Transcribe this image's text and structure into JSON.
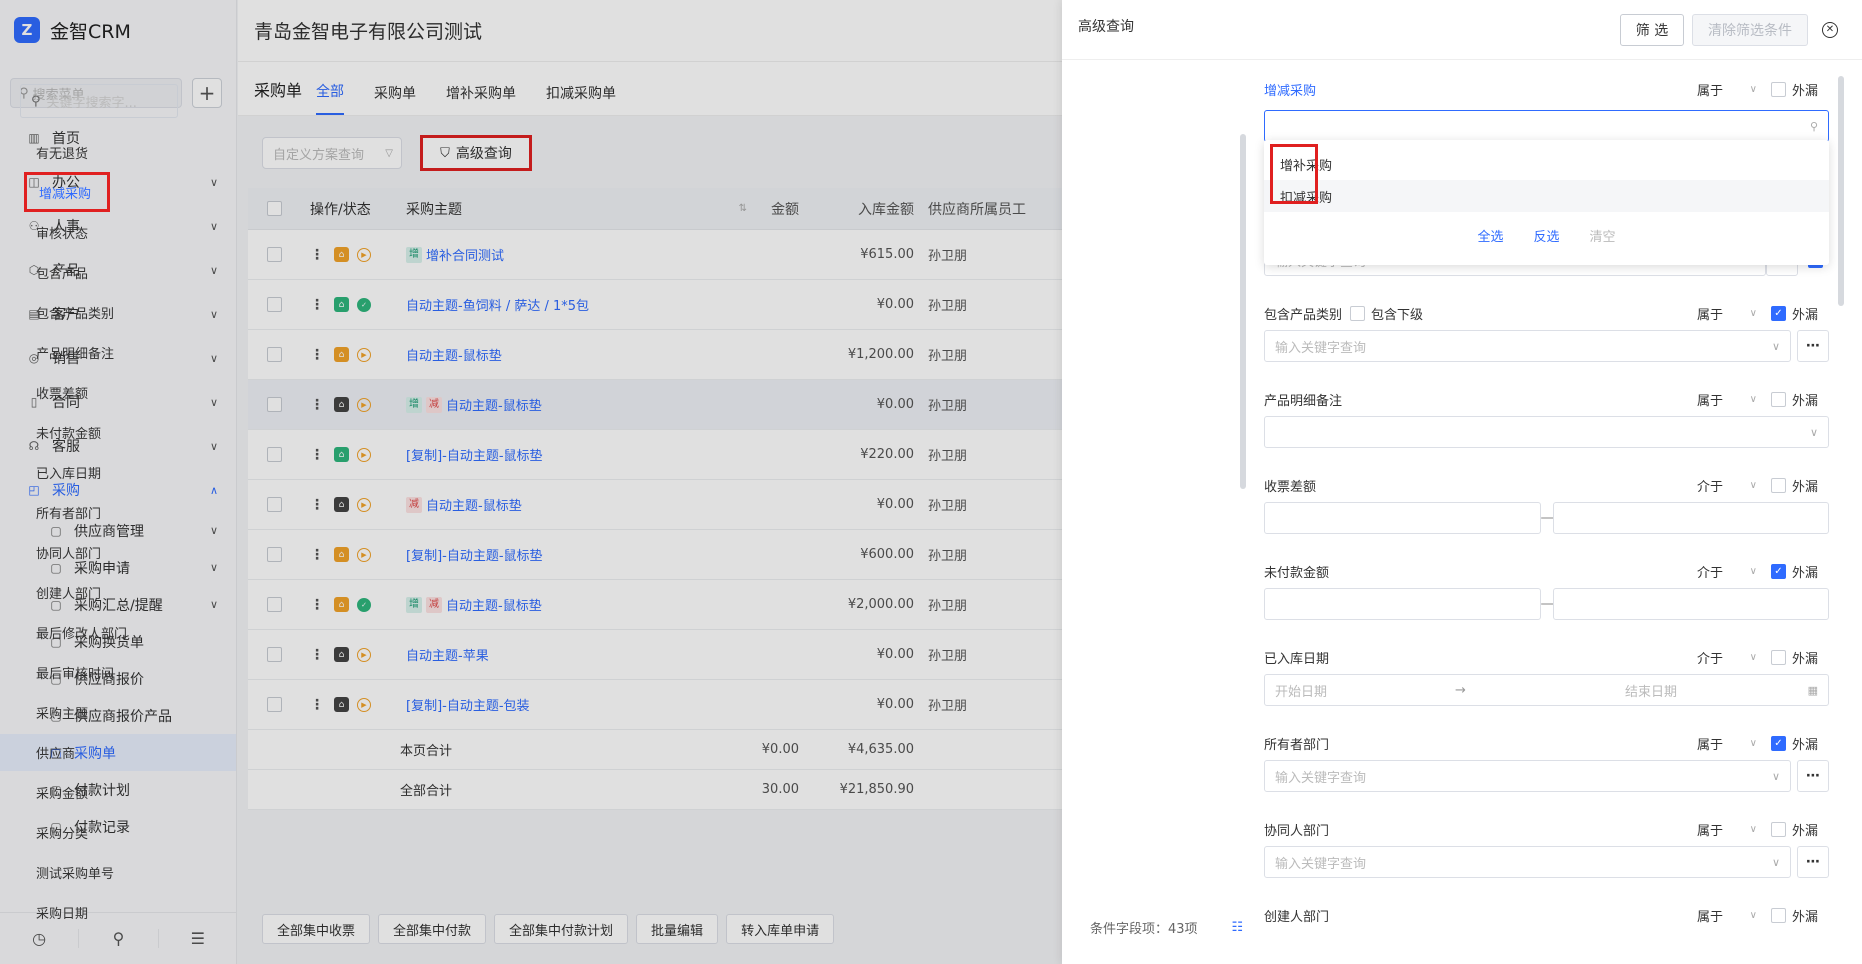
{
  "app": {
    "logo": "Z",
    "name": "金智CRM",
    "company": "青岛金智电子有限公司测试"
  },
  "sidebar": {
    "search_placeholder": "搜索菜单",
    "add": "+",
    "items": [
      {
        "label": "首页",
        "icon": "home-icon",
        "glyph": "▥"
      },
      {
        "label": "办公",
        "icon": "office-icon",
        "glyph": "◫",
        "chevron": "∨"
      },
      {
        "label": "人事",
        "icon": "people-icon",
        "glyph": "⚇",
        "chevron": "∨"
      },
      {
        "label": "产品",
        "icon": "cube-icon",
        "glyph": "⬡",
        "chevron": "∨"
      },
      {
        "label": "客户",
        "icon": "chart-icon",
        "glyph": "▤",
        "chevron": "∨"
      },
      {
        "label": "销售",
        "icon": "target-icon",
        "glyph": "◎",
        "chevron": "∨"
      },
      {
        "label": "合同",
        "icon": "contract-icon",
        "glyph": "▯",
        "chevron": "∨"
      },
      {
        "label": "客服",
        "icon": "headset-icon",
        "glyph": "☊",
        "chevron": "∨"
      },
      {
        "label": "采购",
        "icon": "purchase-icon",
        "glyph": "◰",
        "chevron": "∧"
      }
    ],
    "subitems": [
      {
        "label": "供应商管理",
        "chevron": "∨"
      },
      {
        "label": "采购申请",
        "chevron": "∨"
      },
      {
        "label": "采购汇总/提醒",
        "chevron": "∨"
      },
      {
        "label": "采购换货单"
      },
      {
        "label": "供应商报价"
      },
      {
        "label": "供应商报价产品"
      },
      {
        "label": "采购单"
      },
      {
        "label": "付款计划"
      },
      {
        "label": "付款记录"
      }
    ],
    "bottom": [
      "◷",
      "⚲",
      "☰"
    ]
  },
  "page": {
    "title": "采购单",
    "tabs": [
      "全部",
      "采购单",
      "增补采购单",
      "扣减采购单"
    ],
    "scheme_placeholder": "自定义方案查询",
    "adv_query": "高级查询"
  },
  "table": {
    "headers": {
      "op": "操作/状态",
      "subject": "采购主题",
      "amt1": "金额",
      "amt2": "入库金额",
      "emp": "供应商所属员工"
    },
    "rows": [
      {
        "st": "orange",
        "done": false,
        "tags": [
          "增"
        ],
        "subject": "增补合同测试",
        "amt1": "",
        "amt2": "¥615.00",
        "emp": "孙卫朋"
      },
      {
        "st": "green",
        "done": true,
        "tags": [],
        "subject": "自动主题-鱼饲料 / 萨达 / 1*5包",
        "amt1": "",
        "amt2": "¥0.00",
        "emp": "孙卫朋"
      },
      {
        "st": "orange",
        "done": false,
        "tags": [],
        "subject": "自动主题-鼠标垫",
        "amt1": "",
        "amt2": "¥1,200.00",
        "emp": "孙卫朋"
      },
      {
        "st": "black",
        "done": false,
        "tags": [
          "增",
          "减"
        ],
        "subject": "自动主题-鼠标垫",
        "amt1": "",
        "amt2": "¥0.00",
        "emp": "孙卫朋"
      },
      {
        "st": "green",
        "done": false,
        "tags": [],
        "subject": "[复制]-自动主题-鼠标垫",
        "amt1": "",
        "amt2": "¥220.00",
        "emp": "孙卫朋"
      },
      {
        "st": "black",
        "done": false,
        "tags": [
          "减"
        ],
        "subject": "自动主题-鼠标垫",
        "amt1": "",
        "amt2": "¥0.00",
        "emp": "孙卫朋"
      },
      {
        "st": "orange",
        "done": false,
        "tags": [],
        "subject": "[复制]-自动主题-鼠标垫",
        "amt1": "",
        "amt2": "¥600.00",
        "emp": "孙卫朋"
      },
      {
        "st": "orange",
        "done": true,
        "tags": [
          "增",
          "减"
        ],
        "subject": "自动主题-鼠标垫",
        "amt1": "",
        "amt2": "¥2,000.00",
        "emp": "孙卫朋"
      },
      {
        "st": "black",
        "done": false,
        "tags": [],
        "subject": "自动主题-苹果",
        "amt1": "",
        "amt2": "¥0.00",
        "emp": "孙卫朋"
      },
      {
        "st": "black",
        "done": false,
        "tags": [],
        "subject": "[复制]-自动主题-包装",
        "amt1": "",
        "amt2": "¥0.00",
        "emp": "孙卫朋"
      }
    ],
    "page_total": {
      "label": "本页合计",
      "amt1": "¥0.00",
      "amt2": "¥4,635.00"
    },
    "all_total": {
      "label": "全部合计",
      "amt1": "30.00",
      "amt2": "¥21,850.90"
    }
  },
  "bottom_buttons": [
    "全部集中收票",
    "全部集中付款",
    "全部集中付款计划",
    "批量编辑",
    "转入库单申请"
  ],
  "drawer": {
    "title": "高级查询",
    "filter": "筛 选",
    "clear": "清除筛选条件",
    "close": "✕",
    "field_search_placeholder": "关键字搜索字...",
    "fields": [
      "有无退货",
      "增减采购",
      "审核状态",
      "包含产品",
      "包含产品类别",
      "产品明细备注",
      "收票差额",
      "未付款金额",
      "已入库日期",
      "所有者部门",
      "协同人部门",
      "创建人部门",
      "最后修改人部门",
      "最后审核时间",
      "采购主题",
      "供应商",
      "采购金额",
      "采购分类",
      "测试采购单号",
      "采购日期"
    ],
    "field_count": "条件字段项：43项",
    "dropdown": {
      "options": [
        "增补采购",
        "扣减采购"
      ],
      "select_all": "全选",
      "invert": "反选",
      "clear": "清空"
    },
    "groups": {
      "g1": {
        "label": "增减采购",
        "op": "属于",
        "outer": "外漏"
      },
      "g2": {
        "op": "属于",
        "outer": "外漏",
        "placeholder": "输入关键字查询"
      },
      "g3": {
        "label": "包含产品类别",
        "sub": "包含下级",
        "op": "属于",
        "outer": "外漏",
        "placeholder": "输入关键字查询"
      },
      "g4": {
        "label": "产品明细备注",
        "op": "属于",
        "outer": "外漏"
      },
      "g5": {
        "label": "收票差额",
        "op": "介于",
        "outer": "外漏"
      },
      "g6": {
        "label": "未付款金额",
        "op": "介于",
        "outer": "外漏"
      },
      "g7": {
        "label": "已入库日期",
        "op": "介于",
        "outer": "外漏",
        "start": "开始日期",
        "end": "结束日期"
      },
      "g8": {
        "label": "所有者部门",
        "op": "属于",
        "outer": "外漏",
        "placeholder": "输入关键字查询"
      },
      "g9": {
        "label": "协同人部门",
        "op": "属于",
        "outer": "外漏",
        "placeholder": "输入关键字查询"
      },
      "g10": {
        "label": "创建人部门",
        "op": "属于",
        "outer": "外漏"
      }
    }
  },
  "colors": {
    "accent": "#2f6bff",
    "highlight": "#e02020"
  }
}
